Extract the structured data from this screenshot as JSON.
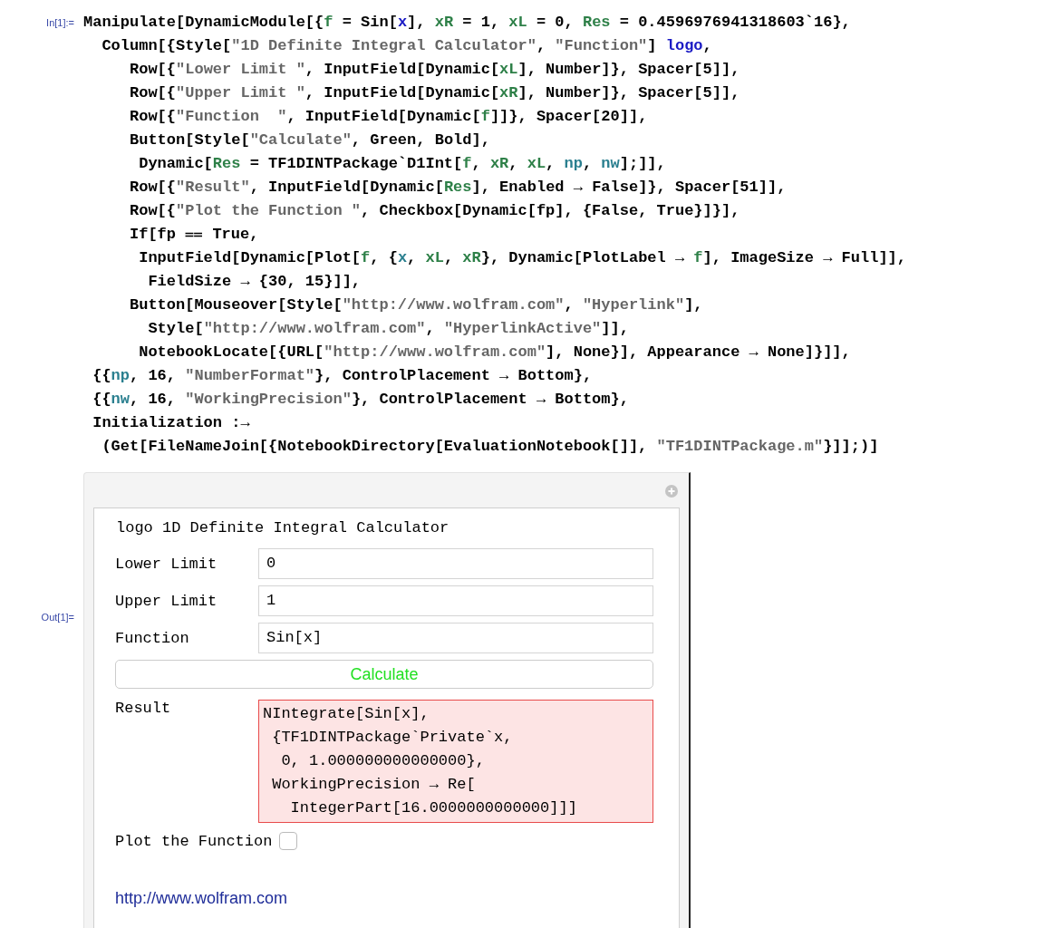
{
  "input_cell": {
    "label": "In[1]:=",
    "lines": [
      [
        {
          "kind": "code",
          "text": "Manipulate[DynamicModule[{"
        },
        {
          "kind": "local",
          "text": "f"
        },
        {
          "kind": "code",
          "text": " = Sin["
        },
        {
          "kind": "undefined",
          "text": "x"
        },
        {
          "kind": "code",
          "text": "], "
        },
        {
          "kind": "local",
          "text": "xR"
        },
        {
          "kind": "code",
          "text": " = 1, "
        },
        {
          "kind": "local",
          "text": "xL"
        },
        {
          "kind": "code",
          "text": " = 0, "
        },
        {
          "kind": "local",
          "text": "Res"
        },
        {
          "kind": "code",
          "text": " = 0.4596976941318603`16},"
        }
      ],
      [
        {
          "kind": "code",
          "text": "  Column[{Style["
        },
        {
          "kind": "string",
          "text": "\"1D Definite Integral Calculator\""
        },
        {
          "kind": "code",
          "text": ", "
        },
        {
          "kind": "string",
          "text": "\"Function\""
        },
        {
          "kind": "code",
          "text": "] "
        },
        {
          "kind": "undefined",
          "text": "logo"
        },
        {
          "kind": "code",
          "text": ","
        }
      ],
      [
        {
          "kind": "code",
          "text": "     Row[{"
        },
        {
          "kind": "string",
          "text": "\"Lower Limit \""
        },
        {
          "kind": "code",
          "text": ", InputField[Dynamic["
        },
        {
          "kind": "local",
          "text": "xL"
        },
        {
          "kind": "code",
          "text": "], Number]}, Spacer[5]],"
        }
      ],
      [
        {
          "kind": "code",
          "text": "     Row[{"
        },
        {
          "kind": "string",
          "text": "\"Upper Limit \""
        },
        {
          "kind": "code",
          "text": ", InputField[Dynamic["
        },
        {
          "kind": "local",
          "text": "xR"
        },
        {
          "kind": "code",
          "text": "], Number]}, Spacer[5]],"
        }
      ],
      [
        {
          "kind": "code",
          "text": "     Row[{"
        },
        {
          "kind": "string",
          "text": "\"Function  \""
        },
        {
          "kind": "code",
          "text": ", InputField[Dynamic["
        },
        {
          "kind": "local",
          "text": "f"
        },
        {
          "kind": "code",
          "text": "]]}, Spacer[20]],"
        }
      ],
      [
        {
          "kind": "code",
          "text": "     Button[Style["
        },
        {
          "kind": "string",
          "text": "\"Calculate\""
        },
        {
          "kind": "code",
          "text": ", Green, Bold],"
        }
      ],
      [
        {
          "kind": "code",
          "text": "      Dynamic["
        },
        {
          "kind": "local",
          "text": "Res"
        },
        {
          "kind": "code",
          "text": " = TF1DINTPackage`D1Int["
        },
        {
          "kind": "local",
          "text": "f"
        },
        {
          "kind": "code",
          "text": ", "
        },
        {
          "kind": "local",
          "text": "xR"
        },
        {
          "kind": "code",
          "text": ", "
        },
        {
          "kind": "local",
          "text": "xL"
        },
        {
          "kind": "code",
          "text": ", "
        },
        {
          "kind": "global",
          "text": "np"
        },
        {
          "kind": "code",
          "text": ", "
        },
        {
          "kind": "global",
          "text": "nw"
        },
        {
          "kind": "code",
          "text": "];]],"
        }
      ],
      [
        {
          "kind": "code",
          "text": "     Row[{"
        },
        {
          "kind": "string",
          "text": "\"Result\""
        },
        {
          "kind": "code",
          "text": ", InputField[Dynamic["
        },
        {
          "kind": "local",
          "text": "Res"
        },
        {
          "kind": "code",
          "text": "], Enabled → False]}, Spacer[51]],"
        }
      ],
      [
        {
          "kind": "code",
          "text": "     Row[{"
        },
        {
          "kind": "string",
          "text": "\"Plot the Function \""
        },
        {
          "kind": "code",
          "text": ", Checkbox[Dynamic[fp], {False, True}]}],"
        }
      ],
      [
        {
          "kind": "code",
          "text": "     If[fp ⩵ True,"
        }
      ],
      [
        {
          "kind": "code",
          "text": "      InputField[Dynamic[Plot["
        },
        {
          "kind": "local",
          "text": "f"
        },
        {
          "kind": "code",
          "text": ", {"
        },
        {
          "kind": "global",
          "text": "x"
        },
        {
          "kind": "code",
          "text": ", "
        },
        {
          "kind": "local",
          "text": "xL"
        },
        {
          "kind": "code",
          "text": ", "
        },
        {
          "kind": "local",
          "text": "xR"
        },
        {
          "kind": "code",
          "text": "}, Dynamic[PlotLabel → "
        },
        {
          "kind": "local",
          "text": "f"
        },
        {
          "kind": "code",
          "text": "], ImageSize → Full]],"
        }
      ],
      [
        {
          "kind": "code",
          "text": "       FieldSize → {30, 15}]],"
        }
      ],
      [
        {
          "kind": "code",
          "text": "     Button[Mouseover[Style["
        },
        {
          "kind": "string",
          "text": "\"http://www.wolfram.com\""
        },
        {
          "kind": "code",
          "text": ", "
        },
        {
          "kind": "string",
          "text": "\"Hyperlink\""
        },
        {
          "kind": "code",
          "text": "],"
        }
      ],
      [
        {
          "kind": "code",
          "text": "       Style["
        },
        {
          "kind": "string",
          "text": "\"http://www.wolfram.com\""
        },
        {
          "kind": "code",
          "text": ", "
        },
        {
          "kind": "string",
          "text": "\"HyperlinkActive\""
        },
        {
          "kind": "code",
          "text": "]],"
        }
      ],
      [
        {
          "kind": "code",
          "text": "      NotebookLocate[{URL["
        },
        {
          "kind": "string",
          "text": "\"http://www.wolfram.com\""
        },
        {
          "kind": "code",
          "text": "], None}], Appearance → None]}]],"
        }
      ],
      [
        {
          "kind": "code",
          "text": " {{"
        },
        {
          "kind": "global",
          "text": "np"
        },
        {
          "kind": "code",
          "text": ", 16, "
        },
        {
          "kind": "string",
          "text": "\"NumberFormat\""
        },
        {
          "kind": "code",
          "text": "}, ControlPlacement → Bottom},"
        }
      ],
      [
        {
          "kind": "code",
          "text": " {{"
        },
        {
          "kind": "global",
          "text": "nw"
        },
        {
          "kind": "code",
          "text": ", 16, "
        },
        {
          "kind": "string",
          "text": "\"WorkingPrecision\""
        },
        {
          "kind": "code",
          "text": "}, ControlPlacement → Bottom},"
        }
      ],
      [
        {
          "kind": "code",
          "text": " Initialization :→"
        }
      ],
      [
        {
          "kind": "code",
          "text": "  (Get[FileNameJoin[{NotebookDirectory[EvaluationNotebook[]], "
        },
        {
          "kind": "string",
          "text": "\"TF1DINTPackage.m\""
        },
        {
          "kind": "code",
          "text": "}]];)]"
        }
      ]
    ]
  },
  "output_cell": {
    "label": "Out[1]=",
    "title": "logo 1D Definite Integral Calculator",
    "fields": [
      {
        "label": "Lower Limit",
        "value": "0",
        "error": false
      },
      {
        "label": "Upper Limit",
        "value": "1",
        "error": false
      },
      {
        "label": "Function",
        "value": "Sin[x]",
        "error": false
      }
    ],
    "button": "Calculate",
    "result": {
      "label": "Result",
      "value": "NIntegrate[Sin[x],\n {TF1DINTPackage`Private`x,\n  0, 1.000000000000000},\n WorkingPrecision → Re[\n   IntegerPart[16.0000000000000]]]",
      "error": true
    },
    "plot_option": {
      "label": "Plot the Function",
      "checked": false
    },
    "link": "http://www.wolfram.com"
  }
}
